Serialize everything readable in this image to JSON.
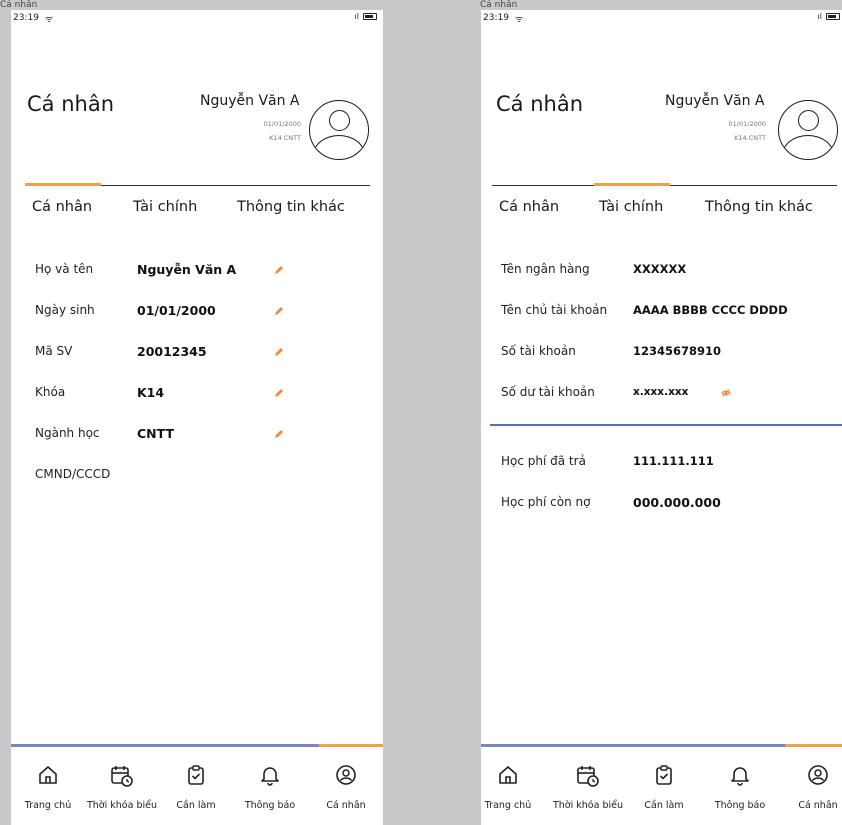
{
  "frames": {
    "left": {
      "label": "Cá nhân",
      "status": {
        "time": "23:19",
        "wifi": "ᯤ",
        "signal": "ıl"
      },
      "title": "Cá nhân",
      "user": {
        "name": "Nguyễn Văn A",
        "dob": "01/01/2000",
        "class": "K14 CNTT"
      },
      "tabs": [
        "Cá nhân",
        "Tài chính",
        "Thông tin khác"
      ],
      "rows": [
        {
          "label": "Họ và tên",
          "value": "Nguyễn Văn A"
        },
        {
          "label": "Ngày sinh",
          "value": "01/01/2000"
        },
        {
          "label": "Mã SV",
          "value": "20012345"
        },
        {
          "label": "Khóa",
          "value": "K14"
        },
        {
          "label": "Ngành học",
          "value": "CNTT"
        },
        {
          "label": "CMND/CCCD",
          "value": ""
        }
      ],
      "nav": [
        "Trang chủ",
        "Thời khóa biểu",
        "Cần làm",
        "Thông báo",
        "Cá nhân"
      ]
    },
    "right": {
      "label": "Cá nhân",
      "status": {
        "time": "23:19",
        "wifi": "ᯤ",
        "signal": "ıl"
      },
      "title": "Cá nhân",
      "user": {
        "name": "Nguyễn Văn A",
        "dob": "01/01/2000",
        "class": "K14 CNTT"
      },
      "tabs": [
        "Cá nhân",
        "Tài chính",
        "Thông tin khác"
      ],
      "bank_rows": [
        {
          "label": "Tên ngân hàng",
          "value": "XXXXXX"
        },
        {
          "label": "Tên chủ tài khoản",
          "value": "AAAA BBBB CCCC DDDD"
        },
        {
          "label": "Số tài khoản",
          "value": "12345678910"
        },
        {
          "label": "Số dư tài khoản",
          "value": "x.xxx.xxx"
        }
      ],
      "fee_rows": [
        {
          "label": "Học phí đã trả",
          "value": "111.111.111"
        },
        {
          "label": "Học phí còn nợ",
          "value": "000.000.000"
        }
      ],
      "nav": [
        "Trang chủ",
        "Thời khóa biểu",
        "Cần làm",
        "Thông báo",
        "Cá nhân"
      ]
    }
  },
  "colors": {
    "accent": "#f0a04b",
    "divider": "#5e6dbd",
    "nav_line": "#7b85c6",
    "edit_icon": "#f08a3c"
  }
}
